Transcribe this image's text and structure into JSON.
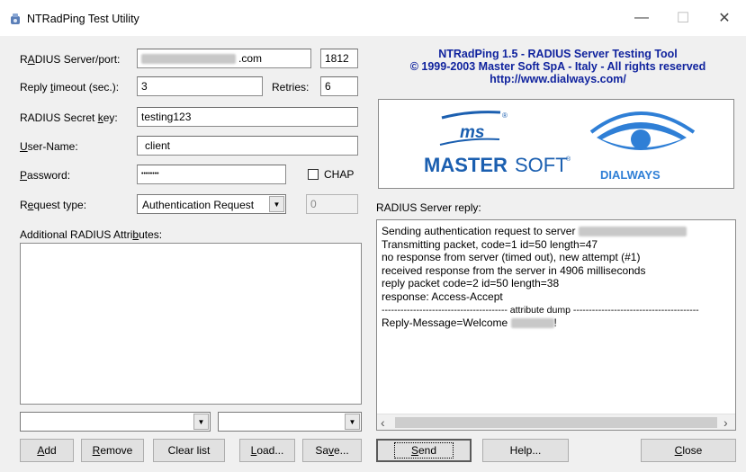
{
  "window": {
    "title": "NTRadPing Test Utility",
    "minimize_glyph": "—",
    "maximize_glyph": "☐",
    "close_glyph": "✕"
  },
  "form": {
    "server_label_pre": "R",
    "server_label_u": "A",
    "server_label_post": "DIUS Server/port:",
    "server_value_suffix": ".com",
    "port_value": "1812",
    "timeout_label_pre": "Reply ",
    "timeout_label_u": "t",
    "timeout_label_post": "imeout (sec.):",
    "timeout_value": "3",
    "retries_label": "Retries:",
    "retries_value": "6",
    "secret_label_pre": "RADIUS Secret ",
    "secret_label_u": "k",
    "secret_label_post": "ey:",
    "secret_value": "testing123",
    "username_label_pre": "",
    "username_label_u": "U",
    "username_label_post": "ser-Name:",
    "username_value": "client",
    "password_label_pre": "",
    "password_label_u": "P",
    "password_label_post": "assword:",
    "password_value": "••••••••",
    "chap_label": "CHAP",
    "request_label_pre": "R",
    "request_label_u": "e",
    "request_label_post": "quest type:",
    "request_value": "Authentication Request",
    "request_number": "0",
    "attributes_label_pre": "Additional RADIUS Attri",
    "attributes_label_u": "b",
    "attributes_label_post": "utes:"
  },
  "left_buttons": {
    "add_u": "A",
    "add_rest": "dd",
    "remove_u": "R",
    "remove_rest": "emove",
    "clear": "Clear list",
    "load_u": "L",
    "load_rest": "oad...",
    "save_pre": "Sa",
    "save_u": "v",
    "save_post": "e..."
  },
  "header": {
    "line1": "NTRadPing 1.5 - RADIUS Server Testing Tool",
    "line2": "© 1999-2003 Master Soft SpA - Italy - All rights reserved",
    "line3": "http://www.dialways.com/"
  },
  "logos": {
    "ms": "ms",
    "master": "MASTER",
    "soft": "SOFT",
    "dialways": "DIALWAYS"
  },
  "reply": {
    "label": "RADIUS Server reply:",
    "lines": [
      "Sending authentication request to server",
      "Transmitting packet, code=1 id=50 length=47",
      "no response from server (timed out), new attempt (#1)",
      "received response from the server in 4906 milliseconds",
      "reply packet code=2 id=50 length=38",
      "response: Access-Accept",
      "---------------------------------------- attribute dump ----------------------------------------",
      "Reply-Message=Welcome"
    ],
    "line8_suffix": "!"
  },
  "right_buttons": {
    "send_u": "S",
    "send_rest": "end",
    "help": "Help...",
    "close_u": "C",
    "close_rest": "lose"
  },
  "icons": {
    "dropdown": "▼",
    "scroll_left": "‹",
    "scroll_right": "›"
  }
}
